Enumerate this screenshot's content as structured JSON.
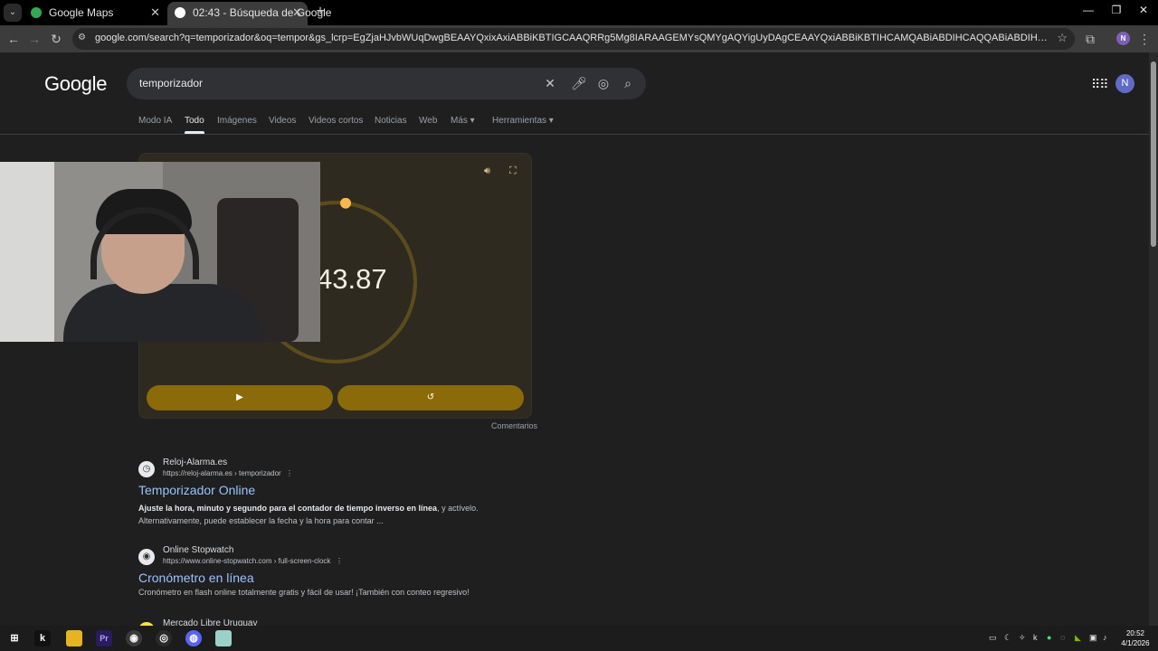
{
  "browser": {
    "tabs": [
      {
        "title": "Google Maps",
        "favicon_color": "#34a853"
      },
      {
        "title": "02:43 - Búsqueda de Google",
        "favicon_color": "#4285f4"
      }
    ],
    "url": "google.com/search?q=temporizador&oq=tempor&gs_lcrp=EgZjaHJvbWUqDwgBEAAYQxixAxiABBiKBTIGCAAQRRg5Mg8IARAAGEMYsQMYgAQYigUyDAgCEAAYQxiABBiKBTIHCAMQABiABDIHCAQQABiABDIHCAUQABiABDIKCAYQABixAxiABDIHCAcQABiABD...",
    "profile_initial": "N"
  },
  "google": {
    "logo": "Google",
    "query": "temporizador",
    "avatar_initial": "N",
    "tabs": [
      {
        "label": "Modo IA"
      },
      {
        "label": "Todo",
        "active": true
      },
      {
        "label": "Imágenes"
      },
      {
        "label": "Videos"
      },
      {
        "label": "Videos cortos"
      },
      {
        "label": "Noticias"
      },
      {
        "label": "Web"
      },
      {
        "label": "Más ▾"
      },
      {
        "label": "Herramientas ▾"
      }
    ]
  },
  "timer": {
    "display": "43.87",
    "progress_remaining_fraction": 0.98,
    "play_icon": "play-icon",
    "reset_icon": "reset-icon",
    "accent_color": "#8a6a09",
    "comments": "Comentarios"
  },
  "results": [
    {
      "site": "Reloj-Alarma.es",
      "breadcrumb": "https://reloj-alarma.es › temporizador",
      "title": "Temporizador Online",
      "snippet_bold": "Ajuste la hora, minuto y segundo para el contador de tiempo inverso en línea",
      "snippet_rest": ", y actívelo. Alternativamente, puede establecer la fecha y la hora para contar ..."
    },
    {
      "site": "Online Stopwatch",
      "breadcrumb": "https://www.online-stopwatch.com › full-screen-clock",
      "title": "Cronómetro en línea",
      "snippet_bold": "",
      "snippet_rest": "Cronómetro en flash online totalmente gratis y fácil de usar! ¡También con conteo regresivo!"
    },
    {
      "site": "Mercado Libre Uruguay"
    }
  ],
  "taskbar": {
    "time": "20:52",
    "date": "4/1/2026"
  }
}
